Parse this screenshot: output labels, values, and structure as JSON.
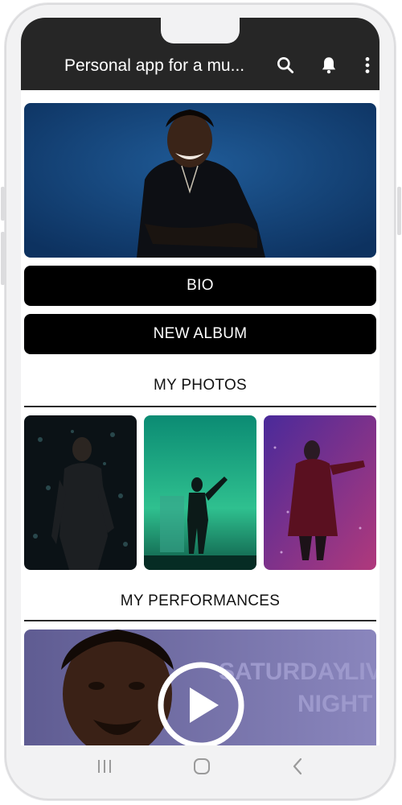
{
  "appbar": {
    "title": "Personal app for a mu...",
    "icons": [
      "search-icon",
      "bell-icon",
      "more-vertical-icon"
    ]
  },
  "buttons": {
    "bio": "BIO",
    "new_album": "NEW ALBUM"
  },
  "sections": {
    "photos_title": "MY PHOTOS",
    "performances_title": "MY PERFORMANCES"
  },
  "video": {
    "backdrop_text_1": "SATURDAY",
    "backdrop_text_2": "NIGHT",
    "backdrop_text_3": "LIV"
  },
  "navbar": {
    "icons": [
      "recent-apps-icon",
      "home-icon",
      "back-icon"
    ]
  },
  "colors": {
    "appbar": "#262626",
    "button_bg": "#000000",
    "button_text": "#ffffff",
    "hero_blue": "#14457a",
    "photo1": "#0b1216",
    "photo2": "#1fae86",
    "photo3": "#6b2f8c",
    "video_bg": "#6f6c9e"
  }
}
